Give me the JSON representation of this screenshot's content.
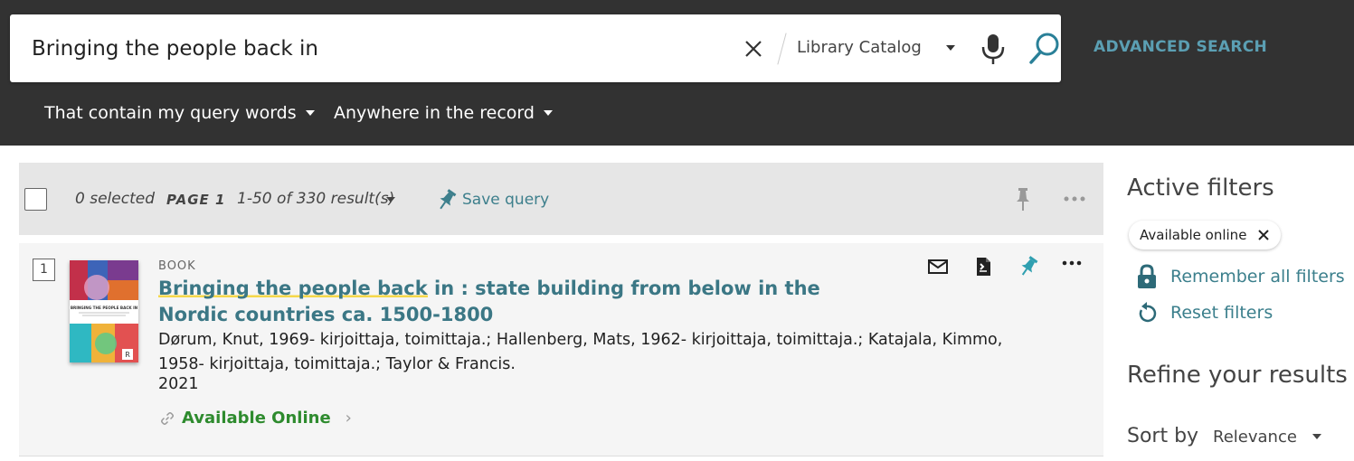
{
  "search": {
    "query": "Bringing the people back in",
    "scope": "Library Catalog",
    "advanced_label": "ADVANCED SEARCH",
    "filter_match": "That contain my query words",
    "filter_field": "Anywhere in the record"
  },
  "toolbar": {
    "selected": "0 selected",
    "page": "PAGE 1",
    "range": "1-50 of 330 result(s)",
    "save_query": "Save query"
  },
  "result": {
    "number": "1",
    "type": "BOOK",
    "title_highlight": "Bringing the people back",
    "title_rest": " in : state building from below in the Nordic countries ca. 1500-1800",
    "authors": "Dørum, Knut, 1969- kirjoittaja, toimittaja.; Hallenberg, Mats, 1962- kirjoittaja, toimittaja.; Katajala, Kimmo, 1958- kirjoittaja, toimittaja.; Taylor & Francis.",
    "year": "2021",
    "availability": "Available Online",
    "cover_title": "BRINGING THE PEOPLE BACK IN"
  },
  "sidebar": {
    "active_filters": "Active filters",
    "chip": "Available online",
    "remember": "Remember all filters",
    "reset": "Reset filters",
    "refine": "Refine your results",
    "sort_label": "Sort by",
    "sort_value": "Relevance"
  },
  "colors": {
    "header_bg": "#323232",
    "accent": "#3b7785",
    "available": "#2e8b2e",
    "highlight": "#f5d84a"
  }
}
